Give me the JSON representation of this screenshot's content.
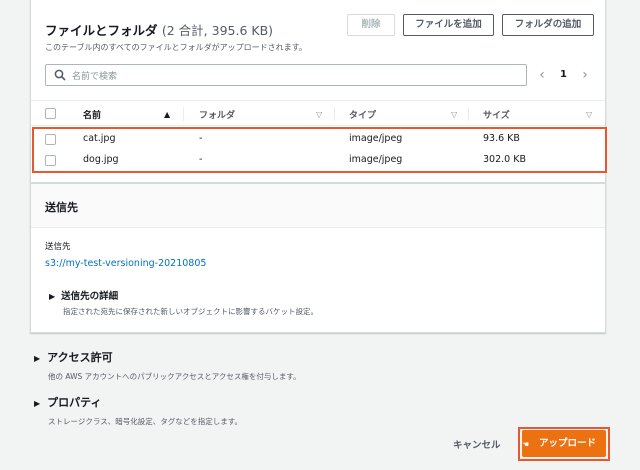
{
  "files": {
    "title": "ファイルとフォルダ",
    "count": "(2 合計, 395.6 KB)",
    "description": "このテーブル内のすべてのファイルとフォルダがアップロードされます。",
    "buttons": {
      "delete": "削除",
      "add_files": "ファイルを追加",
      "add_folder": "フォルダの追加"
    },
    "search": {
      "placeholder": "名前で検索"
    },
    "pagination": {
      "current_page": "1"
    },
    "columns": [
      "名前",
      "フォルダ",
      "タイプ",
      "サイズ"
    ],
    "rows": [
      {
        "name": "cat.jpg",
        "folder": "-",
        "type": "image/jpeg",
        "size": "93.6 KB"
      },
      {
        "name": "dog.jpg",
        "folder": "-",
        "type": "image/jpeg",
        "size": "302.0 KB"
      }
    ]
  },
  "destination": {
    "title": "送信先",
    "label": "送信先",
    "link": "s3://my-test-versioning-20210805",
    "details_title": "送信先の詳細",
    "details_description": "指定された宛先に保存された新しいオブジェクトに影響するバケット設定。"
  },
  "permissions": {
    "title": "アクセス許可",
    "description": "他の AWS アカウントへのパブリックアクセスとアクセス権を付与します。"
  },
  "properties": {
    "title": "プロパティ",
    "description": "ストレージクラス、暗号化設定、タグなどを指定します。"
  },
  "actions": {
    "cancel": "キャンセル",
    "upload": "アップロード"
  },
  "colors": {
    "primary": "#ec7211",
    "link": "#0073bb",
    "highlight": "#e8582c"
  }
}
